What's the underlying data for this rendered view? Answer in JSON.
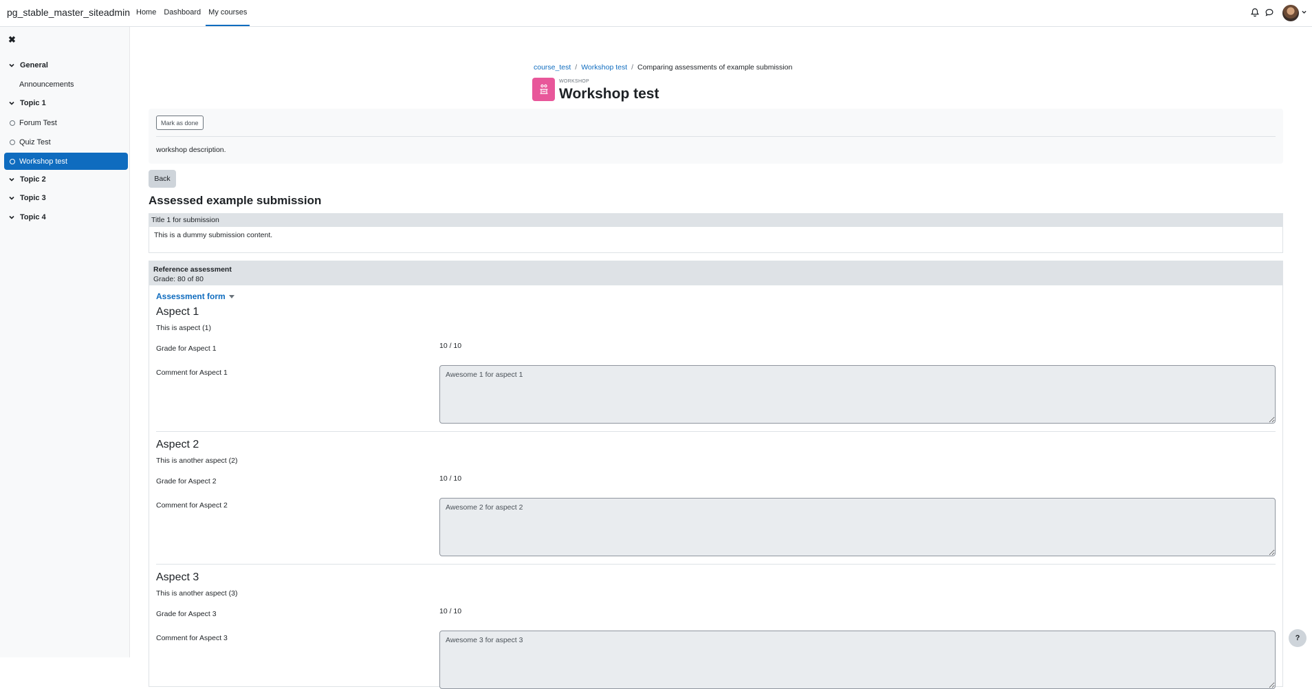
{
  "site": {
    "name": "pg_stable_master_siteadmin"
  },
  "primary_nav": [
    {
      "label": "Home",
      "active": false
    },
    {
      "label": "Dashboard",
      "active": false
    },
    {
      "label": "My courses",
      "active": true
    }
  ],
  "header_icons": [
    "bell-icon",
    "chat-bubble-icon",
    "avatar",
    "chevron-down-icon"
  ],
  "drawer": {
    "close_icon": "close-icon",
    "sections": [
      {
        "label": "General",
        "items": [
          {
            "label": "Announcements",
            "type": "plain"
          }
        ]
      },
      {
        "label": "Topic 1",
        "items": [
          {
            "label": "Forum Test",
            "type": "activity"
          },
          {
            "label": "Quiz Test",
            "type": "activity"
          },
          {
            "label": "Workshop test",
            "type": "activity",
            "active": true
          }
        ]
      },
      {
        "label": "Topic 2",
        "items": []
      },
      {
        "label": "Topic 3",
        "items": []
      },
      {
        "label": "Topic 4",
        "items": []
      }
    ]
  },
  "breadcrumb": {
    "items": [
      "course_test",
      "Workshop test",
      "Comparing assessments of example submission"
    ]
  },
  "activity": {
    "kind": "WORKSHOP",
    "title": "Workshop test",
    "icon": "workshop-icon",
    "icon_color": "#e8579a"
  },
  "completion": {
    "button": "Mark as done",
    "description": "workshop description."
  },
  "back_button": "Back",
  "section_heading": "Assessed example submission",
  "submission": {
    "title": "Title 1 for submission",
    "content": "This is a dummy submission content."
  },
  "assessment": {
    "title": "Reference assessment",
    "grade": "Grade: 80 of 80",
    "form_toggle": "Assessment form",
    "aspects": [
      {
        "title": "Aspect 1",
        "description": "This is aspect (1)",
        "grade_label": "Grade for Aspect 1",
        "grade_value": "10 / 10",
        "comment_label": "Comment for Aspect 1",
        "comment": "Awesome 1 for aspect 1"
      },
      {
        "title": "Aspect 2",
        "description": "This is another aspect (2)",
        "grade_label": "Grade for Aspect 2",
        "grade_value": "10 / 10",
        "comment_label": "Comment for Aspect 2",
        "comment": "Awesome 2 for aspect 2"
      },
      {
        "title": "Aspect 3",
        "description": "This is another aspect (3)",
        "grade_label": "Grade for Aspect 3",
        "grade_value": "10 / 10",
        "comment_label": "Comment for Aspect 3",
        "comment": "Awesome 3 for aspect 3"
      }
    ]
  },
  "help_button": "?",
  "colors": {
    "accent": "#0f6cbf",
    "active_bg": "#0f6cbf",
    "workshop_icon": "#e8579a"
  }
}
